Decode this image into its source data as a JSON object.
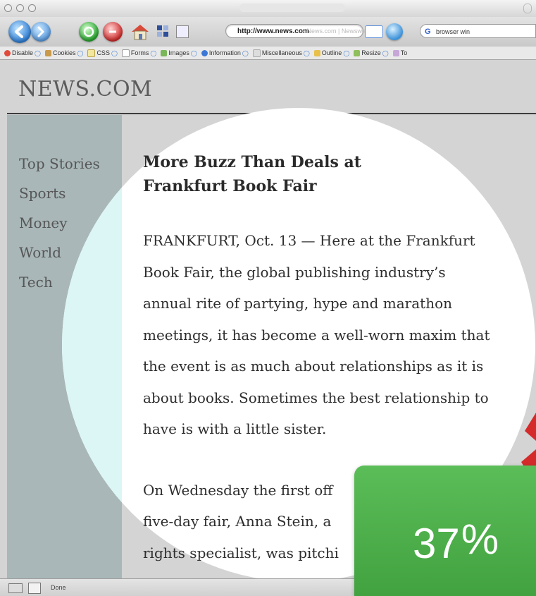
{
  "browser": {
    "url": "http://www.news.com",
    "url_ghost": "·  News.com | Newswell  ·",
    "search_value": "browser win",
    "dev_toolbar": [
      "Disable",
      "Cookies",
      "CSS",
      "Forms",
      "Images",
      "Information",
      "Miscellaneous",
      "Outline",
      "Resize",
      "To"
    ],
    "status": "Done"
  },
  "site": {
    "title": "NEWS.COM",
    "nav": [
      "Top Stories",
      "Sports",
      "Money",
      "World",
      "Tech"
    ]
  },
  "article": {
    "headline_line1": "More Buzz Than Deals at",
    "headline_line2": "Frankfurt Book Fair",
    "para1": [
      "FRANKFURT, Oct. 13 — Here at the Frankfurt",
      "Book Fair, the global publishing industry’s",
      "annual rite of partying, hype and marathon",
      "meetings, it has become a well-worn maxim that",
      "the event is as much about relationships as it is",
      "about books. Sometimes the best relationship to",
      "have is with a little sister."
    ],
    "para2": [
      "On Wednesday the first off",
      "five-day fair, Anna Stein, a",
      "rights specialist, was pitchi"
    ]
  },
  "badge": {
    "value": "37",
    "unit": "%",
    "color": "#4caf4c"
  },
  "colors": {
    "sidebar": "#a9b7b8",
    "lens": "#ffffff",
    "accent_red": "#d42a2a"
  }
}
